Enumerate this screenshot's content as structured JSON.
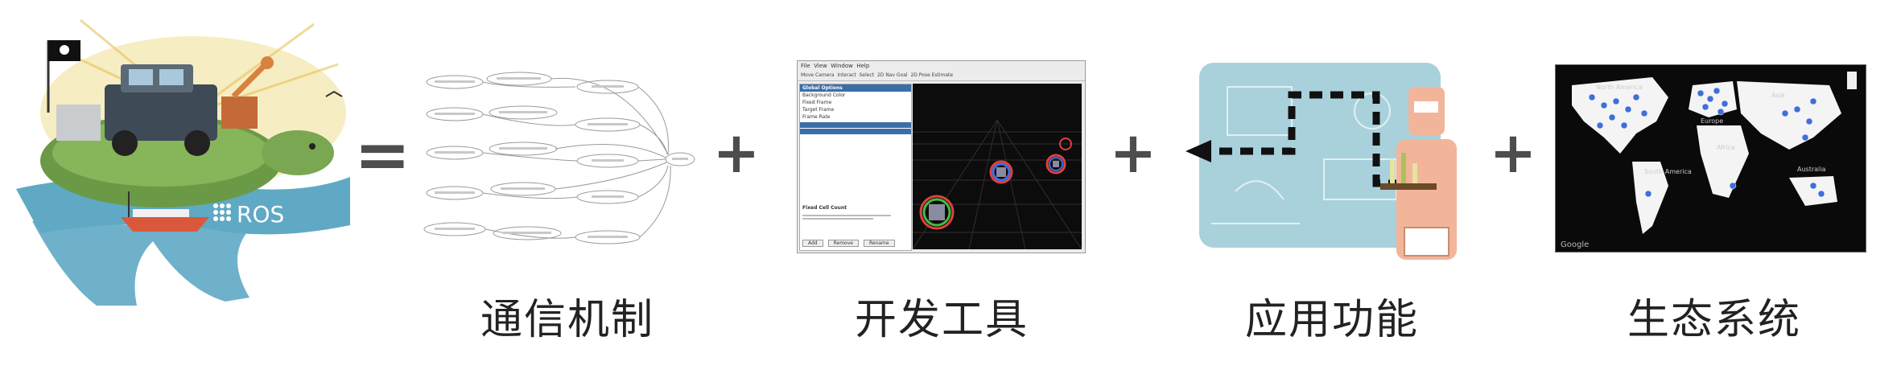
{
  "ros": {
    "logo_text": "ROS"
  },
  "operators": {
    "equals": "=",
    "plus": "+"
  },
  "captions": {
    "communication": "通信机制",
    "tools": "开发工具",
    "capabilities": "应用功能",
    "ecosystem": "生态系统"
  },
  "tools_window": {
    "menu": [
      "File",
      "View",
      "Window",
      "Help"
    ],
    "tabs": [
      "Move Camera",
      "Interact",
      "Select",
      "2D Nav Goal",
      "2D Pose Estimate"
    ],
    "properties_header": "Global Options",
    "property_rows": [
      "Background Color",
      "Fixed Frame",
      "Target Frame",
      "Frame Rate"
    ],
    "status_title": "Fixed Cell Count",
    "buttons": [
      "Add",
      "Remove",
      "Rename"
    ]
  },
  "map": {
    "labels": [
      "North America",
      "South America",
      "Europe",
      "Africa",
      "Asia",
      "Australia"
    ],
    "brand": "Google"
  }
}
